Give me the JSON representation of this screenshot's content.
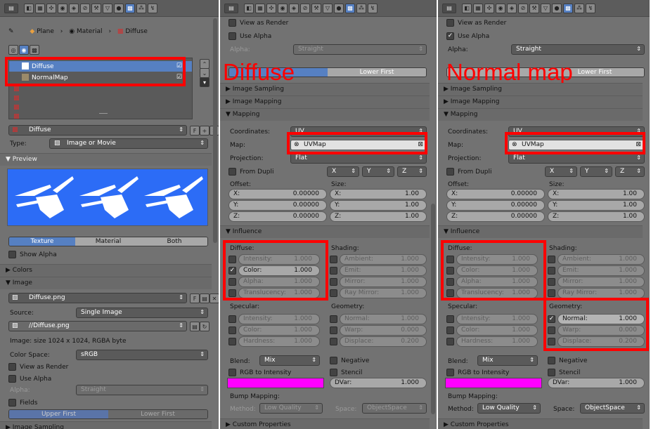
{
  "panel1": {
    "breadcrumb": [
      "Plane",
      "Material",
      "Diffuse"
    ],
    "slots": [
      "Diffuse",
      "NormalMap"
    ],
    "texture_name": "Diffuse",
    "texture_name_f": "F",
    "type_label": "Type:",
    "type_value": "Image or Movie",
    "preview_header": "▼ Preview",
    "tabs": [
      "Texture",
      "Material",
      "Both"
    ],
    "show_alpha": "Show Alpha",
    "colors_header": "▶ Colors",
    "image_header": "▼ Image",
    "image_name": "Diffuse.png",
    "image_name_f": "F",
    "source_label": "Source:",
    "source_value": "Single Image",
    "filepath": "//Diffuse.png",
    "image_info": "Image: size 1024 x 1024, RGBA byte",
    "color_space_label": "Color Space:",
    "color_space_value": "sRGB",
    "view_as_render": "View as Render",
    "use_alpha": "Use Alpha",
    "alpha_label": "Alpha:",
    "alpha_value": "Straight",
    "fields": "Fields",
    "field_order": [
      "Upper First",
      "Lower First"
    ],
    "image_sampling": "▶ Image Sampling"
  },
  "mid": {
    "view_as_render": "View as Render",
    "use_alpha": "Use Alpha",
    "use_alpha_checked_2": "✓",
    "alpha_label": "Alpha:",
    "alpha_value": "Straight",
    "fields": "Fields",
    "lower_first": "Lower First",
    "image_sampling": "▶ Image Sampling",
    "image_mapping": "▶ Image Mapping",
    "mapping": "▼ Mapping",
    "coordinates_label": "Coordinates:",
    "coordinates_value": "UV",
    "map_label": "Map:",
    "map_value": "UVMap",
    "projection_label": "Projection:",
    "projection_value": "Flat",
    "from_dupli": "From Dupli",
    "axes": [
      "X",
      "Y",
      "Z"
    ],
    "offset_label": "Offset:",
    "size_label": "Size:",
    "offset": [
      {
        "k": "X:",
        "v": "0.00000"
      },
      {
        "k": "Y:",
        "v": "0.00000"
      },
      {
        "k": "Z:",
        "v": "0.00000"
      }
    ],
    "size": [
      {
        "k": "X:",
        "v": "1.00"
      },
      {
        "k": "Y:",
        "v": "1.00"
      },
      {
        "k": "Z:",
        "v": "1.00"
      }
    ],
    "influence": "▼ Influence",
    "diffuse_label": "Diffuse:",
    "diffuse": [
      {
        "k": "Intensity:",
        "v": "1.000"
      },
      {
        "k": "Color:",
        "v": "1.000"
      },
      {
        "k": "Alpha:",
        "v": "1.000"
      },
      {
        "k": "Translucency:",
        "v": "1.000"
      }
    ],
    "shading_label": "Shading:",
    "shading": [
      {
        "k": "Ambient:",
        "v": "1.000"
      },
      {
        "k": "Emit:",
        "v": "1.000"
      },
      {
        "k": "Mirror:",
        "v": "1.000"
      },
      {
        "k": "Ray Mirror:",
        "v": "1.000"
      }
    ],
    "specular_label": "Specular:",
    "specular": [
      {
        "k": "Intensity:",
        "v": "1.000"
      },
      {
        "k": "Color:",
        "v": "1.000"
      },
      {
        "k": "Hardness:",
        "v": "1.000"
      }
    ],
    "geometry_label": "Geometry:",
    "geometry": [
      {
        "k": "Normal:",
        "v": "1.000"
      },
      {
        "k": "Warp:",
        "v": "0.000"
      },
      {
        "k": "Displace:",
        "v": "0.200"
      }
    ],
    "blend_label": "Blend:",
    "blend_value": "Mix",
    "negative": "Negative",
    "rgb_to_intensity": "RGB to Intensity",
    "stencil": "Stencil",
    "dvar_label": "DVar:",
    "dvar_value": "1.000",
    "bump_mapping": "Bump Mapping:",
    "method_label": "Method:",
    "method_value": "Low Quality",
    "space_label": "Space:",
    "space_value": "ObjectSpace",
    "custom_properties": "▶ Custom Properties"
  },
  "overlays": {
    "left": "Diffuse",
    "right": "Normal map"
  },
  "colors": {
    "panel": "#727272",
    "highlight": "#ff0000",
    "select": "#5680c2",
    "swatch": "#ff00ff",
    "preview": "#2c6cf6"
  }
}
